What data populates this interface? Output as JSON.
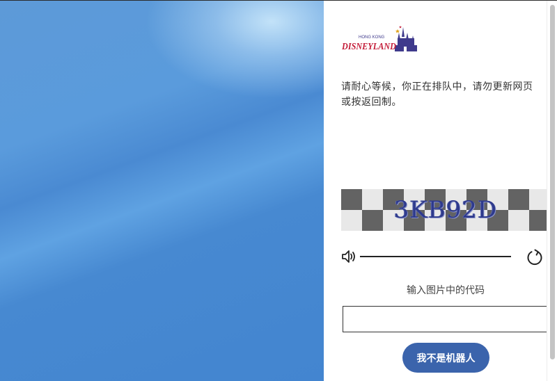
{
  "logo": {
    "top_text": "HONG KONG",
    "brand_text": "DISNEYLAND",
    "icon": "castle-icon",
    "colors": {
      "red": "#c41e3a",
      "navy": "#3f3a8c"
    }
  },
  "queue": {
    "message": "请耐心等候，你正在排队中，请勿更新网页或按返回制。"
  },
  "captcha": {
    "code": "3KB92D",
    "audio_icon": "speaker-icon",
    "refresh_icon": "refresh-icon",
    "prompt": "输入图片中的代码",
    "input_value": "",
    "submit_label": "我不是机器人"
  },
  "colors": {
    "hero_blue": "#4385d0",
    "button_blue": "#3b64ac",
    "checker_dark": "#636363",
    "checker_light": "#e8e8e8"
  }
}
